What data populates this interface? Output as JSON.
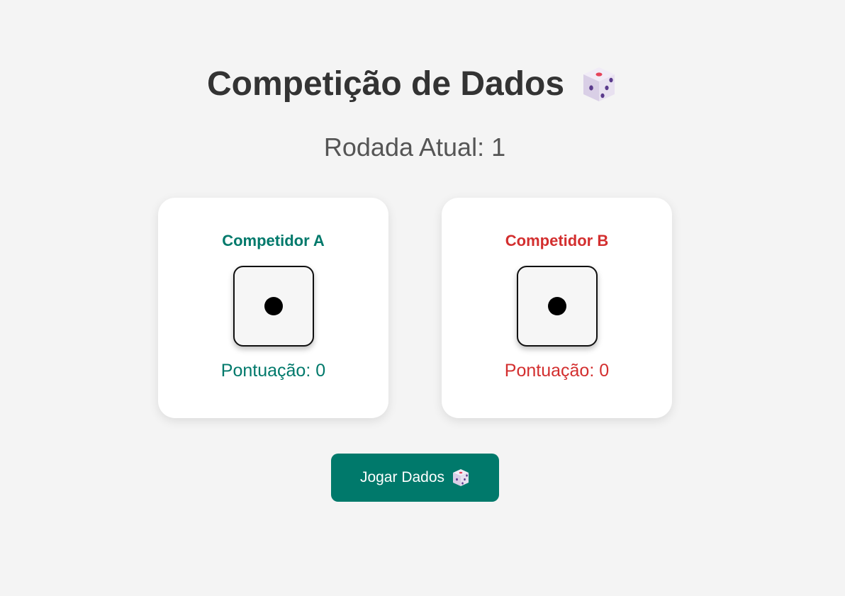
{
  "header": {
    "title": "Competição de Dados",
    "title_icon": "game-die-icon"
  },
  "round": {
    "label": "Rodada Atual:",
    "value": "1"
  },
  "players": [
    {
      "name": "Competidor A",
      "color": "#00796b",
      "die_face": 1,
      "score_label": "Pontuação:",
      "score": "0"
    },
    {
      "name": "Competidor B",
      "color": "#d32f2f",
      "die_face": 1,
      "score_label": "Pontuação:",
      "score": "0"
    }
  ],
  "controls": {
    "roll_label": "Jogar Dados",
    "roll_icon": "game-die-icon",
    "roll_color": "#00796b"
  },
  "colors": {
    "background": "#f4f4f4",
    "title": "#333333",
    "round_text": "#555555"
  }
}
